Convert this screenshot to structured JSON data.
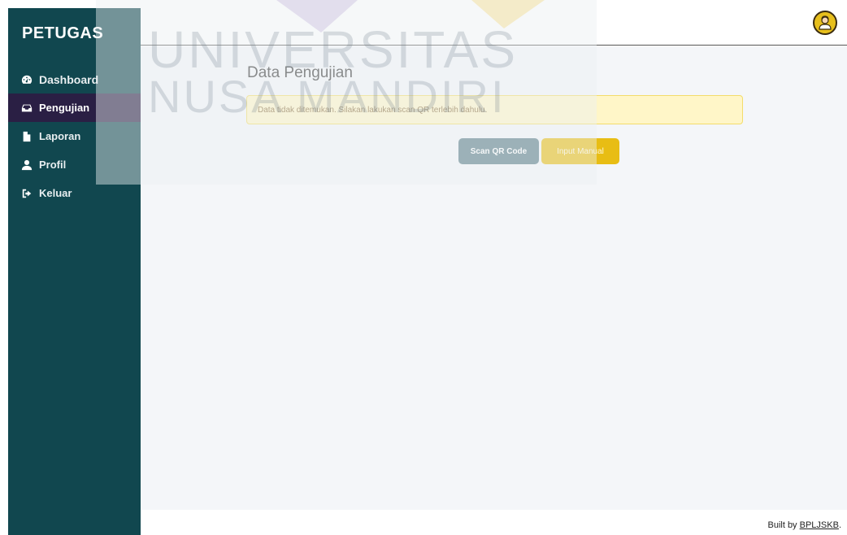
{
  "sidebar": {
    "brand": "PETUGAS",
    "items": [
      {
        "label": "Dashboard",
        "icon": "tachometer-icon"
      },
      {
        "label": "Pengujian",
        "icon": "inbox-icon",
        "active": true
      },
      {
        "label": "Laporan",
        "icon": "file-icon"
      },
      {
        "label": "Profil",
        "icon": "user-icon"
      },
      {
        "label": "Keluar",
        "icon": "sign-out-icon"
      }
    ]
  },
  "header": {
    "avatar_icon": "user-avatar-icon"
  },
  "main": {
    "title": "Data Pengujian",
    "alert": "Data tidak ditemukan. Silakan lakukan scan QR terlebih dahulu.",
    "scan_button": "Scan QR Code",
    "manual_button": "Input Manual"
  },
  "footer": {
    "prefix": "Built by ",
    "link": "BPLJSKB",
    "suffix": "."
  },
  "watermark": {
    "line1": "UNIVERSITAS",
    "line2": "NUSA MANDIRI"
  },
  "colors": {
    "sidebar_bg": "#11474f",
    "active_item_bg": "#2a1f44",
    "alert_bg": "#fff6c8",
    "scan_button_bg": "#5c7f89",
    "manual_button_bg": "#e8bd14"
  }
}
